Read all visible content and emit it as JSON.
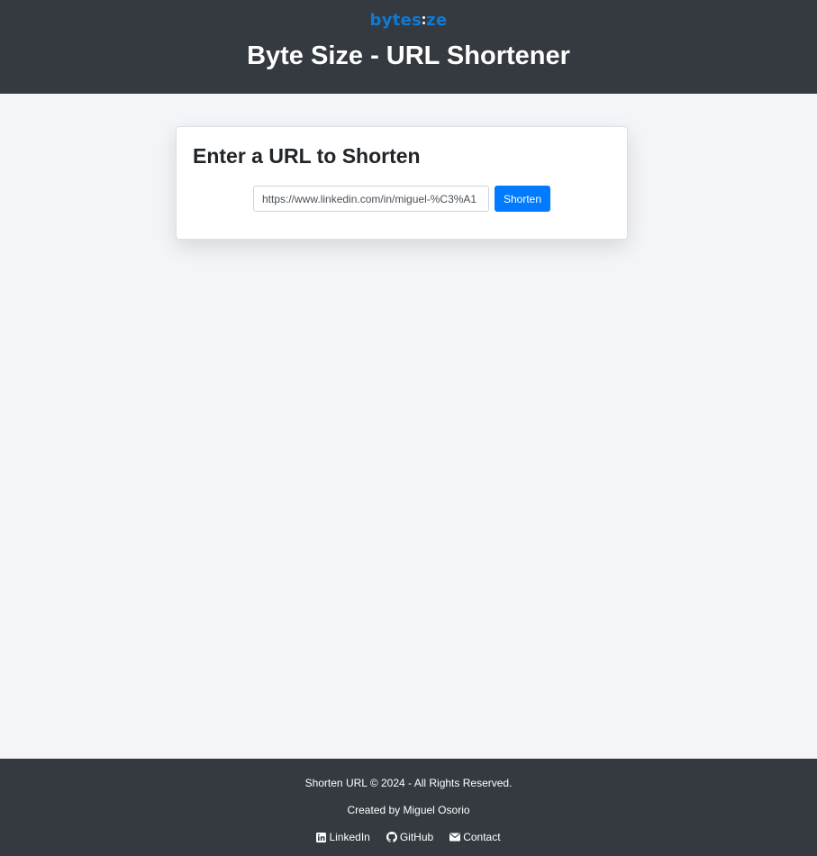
{
  "header": {
    "logo": {
      "left": "bytes",
      "right": "ze"
    },
    "title": "Byte Size - URL Shortener"
  },
  "card": {
    "title": "Enter a URL to Shorten",
    "input_value": "https://www.linkedin.com/in/miguel-%C3%A1",
    "input_placeholder": "",
    "button_label": "Shorten"
  },
  "footer": {
    "copyright": "Shorten URL © 2024 - All Rights Reserved.",
    "created_by": "Created by Miguel Osorio",
    "links": [
      {
        "label": "LinkedIn",
        "icon": "linkedin-icon"
      },
      {
        "label": "GitHub",
        "icon": "github-icon"
      },
      {
        "label": "Contact",
        "icon": "envelope-icon"
      }
    ]
  },
  "colors": {
    "header_bg": "#343a40",
    "page_bg": "#f4f5f9",
    "accent": "#007bff",
    "logo": "#0d7bd6"
  }
}
